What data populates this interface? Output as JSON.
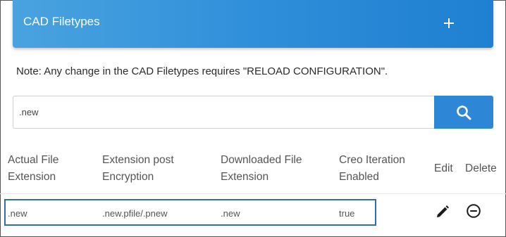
{
  "panel": {
    "title": "CAD Filetypes",
    "add_icon": "plus-icon"
  },
  "note": "Note: Any change in the CAD Filetypes requires \"RELOAD CONFIGURATION\".",
  "search": {
    "value": ".new",
    "button_icon": "search-icon"
  },
  "table": {
    "columns": [
      {
        "line1": "Actual File",
        "line2": "Extension"
      },
      {
        "line1": "Extension post",
        "line2": "Encryption"
      },
      {
        "line1": "Downloaded File",
        "line2": "Extension"
      },
      {
        "line1": "Creo Iteration",
        "line2": "Enabled"
      },
      {
        "line1": "Edit"
      },
      {
        "line1": "Delete"
      }
    ],
    "rows": [
      {
        "actual_extension": ".new",
        "post_encryption": ".new.pfile/.pnew",
        "downloaded_extension": ".new",
        "creo_iteration_enabled": "true",
        "edit_icon": "pencil-icon",
        "delete_icon": "minus-circle-icon"
      }
    ]
  },
  "colors": {
    "header_gradient_start": "#4aa3df",
    "header_gradient_end": "#1f7fd1",
    "search_button": "#2d86d6",
    "row_highlight": "#2e6fa8"
  }
}
